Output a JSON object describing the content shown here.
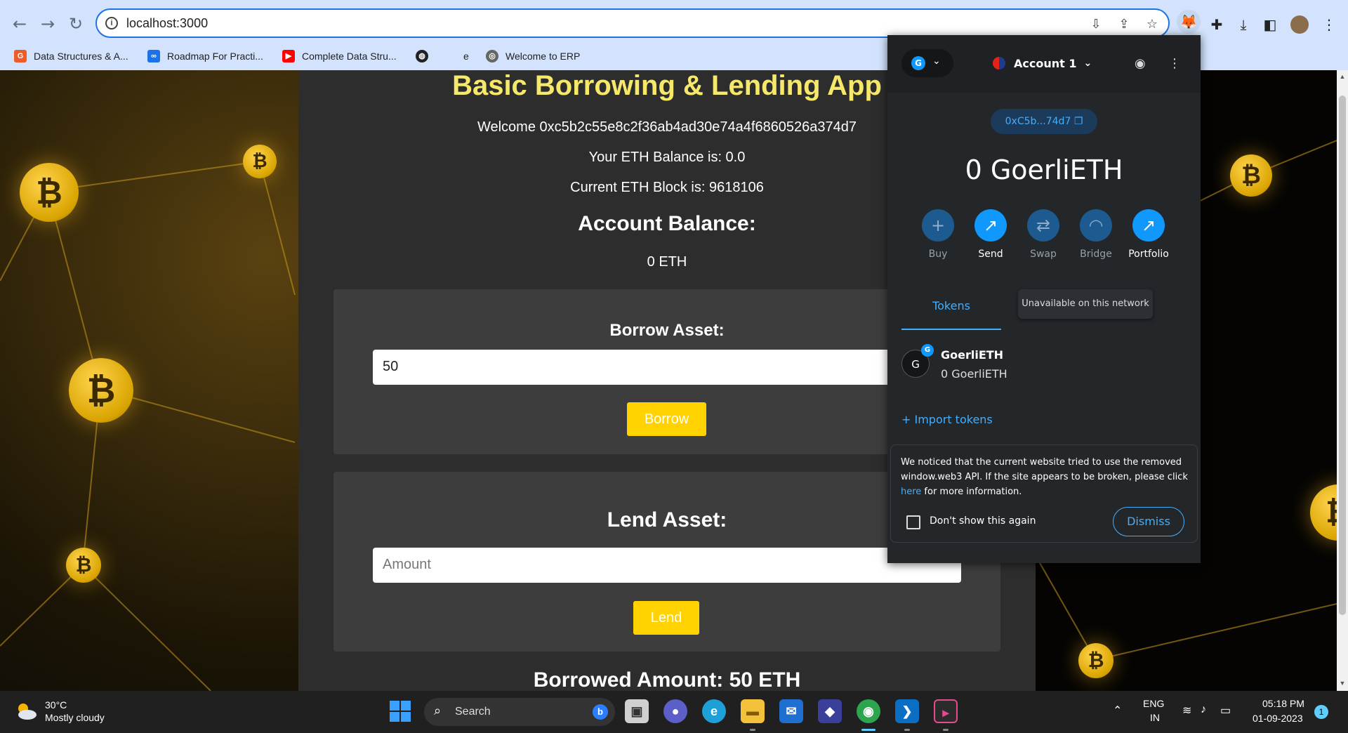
{
  "browser": {
    "url": "localhost:3000",
    "bookmarks": [
      {
        "label": "Data Structures & A...",
        "icon": "gfg-icon",
        "color": "#f05a28"
      },
      {
        "label": "Roadmap For Practi...",
        "icon": "infinity-icon",
        "color": "#1a73e8"
      },
      {
        "label": "Complete Data Stru...",
        "icon": "youtube-icon",
        "color": "#ff0000"
      },
      {
        "label": "",
        "icon": "globe-icon",
        "color": "#202124"
      },
      {
        "label": "e",
        "icon": "e-icon",
        "color": "#202124"
      },
      {
        "label": "Welcome to ERP",
        "icon": "erp-icon",
        "color": "#555555"
      }
    ]
  },
  "app": {
    "title": "Basic Borrowing & Lending App",
    "welcome": "Welcome 0xc5b2c55e8c2f36ab4ad30e74a4f6860526a374d7",
    "eth_balance": "Your ETH Balance is: 0.0",
    "eth_block": "Current ETH Block is: 9618106",
    "account_balance_heading": "Account Balance:",
    "account_balance_value": "0 ETH",
    "borrow": {
      "heading": "Borrow Asset:",
      "value": "50",
      "button": "Borrow"
    },
    "lend": {
      "heading": "Lend Asset:",
      "placeholder": "Amount",
      "button": "Lend"
    },
    "borrowed_amount": "Borrowed Amount: 50 ETH"
  },
  "metamask": {
    "network_initial": "G",
    "account_name": "Account 1",
    "address": "0xC5b...74d7",
    "balance": "0 GoerliETH",
    "actions": [
      {
        "label": "Buy",
        "icon": "plus-icon",
        "glyph": "+",
        "enabled": false
      },
      {
        "label": "Send",
        "icon": "arrow-up-right-icon",
        "glyph": "↗",
        "enabled": true
      },
      {
        "label": "Swap",
        "icon": "swap-icon",
        "glyph": "⇄",
        "enabled": false
      },
      {
        "label": "Bridge",
        "icon": "bridge-icon",
        "glyph": "◠",
        "enabled": false
      },
      {
        "label": "Portfolio",
        "icon": "chart-icon",
        "glyph": "↗",
        "enabled": true
      }
    ],
    "tooltip": "Unavailable on this network",
    "tab": "Tokens",
    "token": {
      "initial": "G",
      "badge": "G",
      "name": "GoerliETH",
      "amount": "0 GoerliETH"
    },
    "import_tokens": "+ Import tokens",
    "notice": {
      "text_before": "We noticed that the current website tried to use the removed window.web3 API. If the site appears to be broken, please click ",
      "link": "here",
      "text_after": " for more information.",
      "checkbox_label": "Don't show this again",
      "dismiss": "Dismiss"
    }
  },
  "taskbar": {
    "weather_temp": "30°C",
    "weather_desc": "Mostly cloudy",
    "search_label": "Search",
    "lang": "ENG",
    "region": "IN",
    "time": "05:18 PM",
    "date": "01-09-2023",
    "notification_count": "1"
  },
  "colors": {
    "accent_yellow": "#ffd200",
    "title_yellow": "#f5e86a",
    "metamask_blue": "#43aefc"
  }
}
